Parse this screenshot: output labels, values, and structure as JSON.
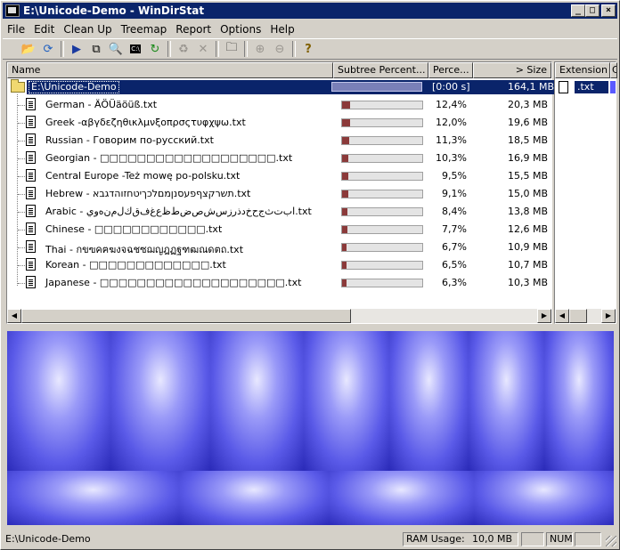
{
  "window": {
    "title": "E:\\Unicode-Demo - WinDirStat"
  },
  "menu": [
    "File",
    "Edit",
    "Clean Up",
    "Treemap",
    "Report",
    "Options",
    "Help"
  ],
  "columns": {
    "name": "Name",
    "subtree": "Subtree Percent...",
    "percent": "Perce...",
    "size": "> Size"
  },
  "ext_columns": {
    "extension": "Extension",
    "color": "C"
  },
  "root": {
    "name": "E:\\Unicode-Demo",
    "time": "[0:00 s]",
    "size": "164,1 MB"
  },
  "files": [
    {
      "name": "German - ÄÖÜäöüß.txt",
      "fraction": 0.124,
      "percent": "12,4%",
      "size": "20,3 MB"
    },
    {
      "name": "Greek -αβγδεζηθικλμνξοπρσςτυφχψω.txt",
      "fraction": 0.12,
      "percent": "12,0%",
      "size": "19,6 MB"
    },
    {
      "name": "Russian - Говорим по-русский.txt",
      "fraction": 0.113,
      "percent": "11,3%",
      "size": "18,5 MB"
    },
    {
      "name": "Georgian - □□□□□□□□□□□□□□□□□□□.txt",
      "fraction": 0.103,
      "percent": "10,3%",
      "size": "16,9 MB"
    },
    {
      "name": "Central Europe -Też mowę po-polsku.txt",
      "fraction": 0.095,
      "percent": "9,5%",
      "size": "15,5 MB"
    },
    {
      "name": "Hebrew - תשרקצףפעסנןמםלכךיטחזוהדגבא.txt",
      "fraction": 0.091,
      "percent": "9,1%",
      "size": "15,0 MB"
    },
    {
      "name": "Arabic - ﺍﺏﺕﺙﺝﺡﺥﺩﺫﺭﺯﺱﺵﺹﺽﻁﻅﻉﻍﻑﻕﻙﻝﻡﻥﻩﻭﻱ.txt",
      "fraction": 0.084,
      "percent": "8,4%",
      "size": "13,8 MB"
    },
    {
      "name": "Chinese - □□□□□□□□□□□□.txt",
      "fraction": 0.077,
      "percent": "7,7%",
      "size": "12,6 MB"
    },
    {
      "name": "Thai - กขฃคฅฆงจฉชซฌญฎฏฐฑฒณดตถ.txt",
      "fraction": 0.067,
      "percent": "6,7%",
      "size": "10,9 MB"
    },
    {
      "name": "Korean - □□□□□□□□□□□□□.txt",
      "fraction": 0.065,
      "percent": "6,5%",
      "size": "10,7 MB"
    },
    {
      "name": "Japanese - □□□□□□□□□□□□□□□□□□□□.txt",
      "fraction": 0.063,
      "percent": "6,3%",
      "size": "10,3 MB"
    }
  ],
  "extensions": [
    {
      "name": ".txt",
      "color": "#5a5aff"
    }
  ],
  "treemap_color": "#3a3ad8",
  "status": {
    "path": "E:\\Unicode-Demo",
    "ram_label": "RAM Usage:",
    "ram_value": "10,0 MB",
    "num": "NUM"
  }
}
